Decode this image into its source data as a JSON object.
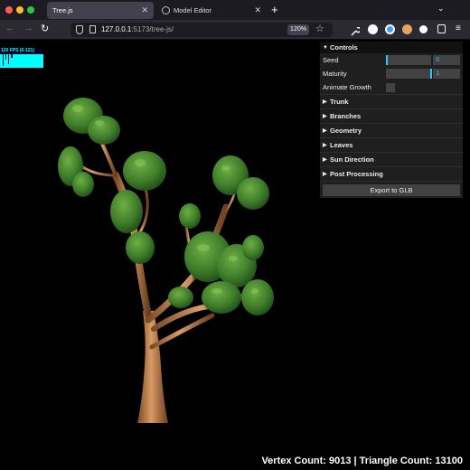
{
  "browser": {
    "tabs": [
      {
        "label": "Tree.js",
        "active": true
      },
      {
        "label": "Model Editor",
        "active": false
      }
    ],
    "url_host": "127.0.0.1",
    "url_path": ":5173/tree-js/",
    "zoom": "120%",
    "colors": {
      "traffic_red": "#ff5f57",
      "traffic_yellow": "#febc2e",
      "traffic_green": "#28c840"
    }
  },
  "fps": {
    "label": "120 FPS (6-121)"
  },
  "gui": {
    "title": "Controls",
    "seed": {
      "label": "Seed",
      "value": "0",
      "fraction": 0.0
    },
    "maturity": {
      "label": "Maturity",
      "value": "1",
      "fraction": 1.0
    },
    "animate": {
      "label": "Animate Growth",
      "checked": false
    },
    "folders": [
      "Trunk",
      "Branches",
      "Geometry",
      "Leaves",
      "Sun Direction",
      "Post Processing"
    ],
    "export_label": "Export to GLB",
    "accent": "#2cc9ff"
  },
  "stats": {
    "text": "Vertex Count: 9013 | Triangle Count: 13100"
  }
}
